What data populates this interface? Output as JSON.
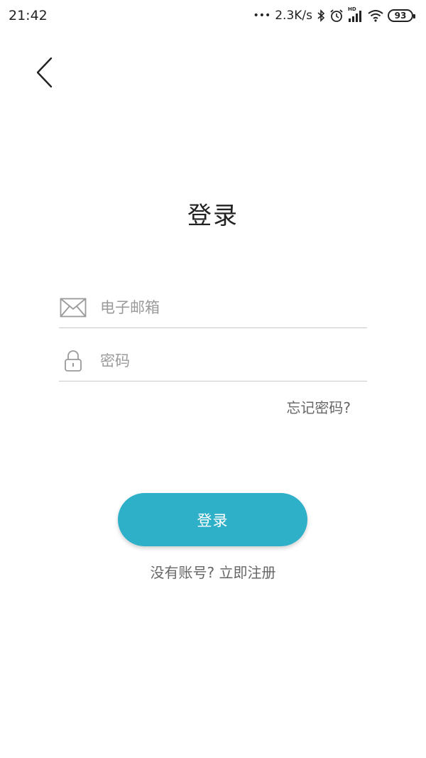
{
  "status_bar": {
    "time": "21:42",
    "dots": "•••",
    "net_speed": "2.3K/s",
    "hd_label": "HD",
    "battery": "93",
    "icons": [
      "bluetooth-icon",
      "alarm-icon",
      "signal-icon",
      "wifi-icon",
      "battery-icon"
    ]
  },
  "header": {
    "back_icon": "chevron-left-icon",
    "title": "登录"
  },
  "form": {
    "email": {
      "icon": "mail-icon",
      "placeholder": "电子邮箱",
      "value": ""
    },
    "password": {
      "icon": "lock-icon",
      "placeholder": "密码",
      "value": ""
    },
    "forgot_label": "忘记密码?"
  },
  "actions": {
    "login_label": "登录",
    "register_label": "没有账号? 立即注册"
  },
  "colors": {
    "accent": "#2fb0c9",
    "divider": "#c9c9c9",
    "placeholder": "#9a9a9a"
  }
}
